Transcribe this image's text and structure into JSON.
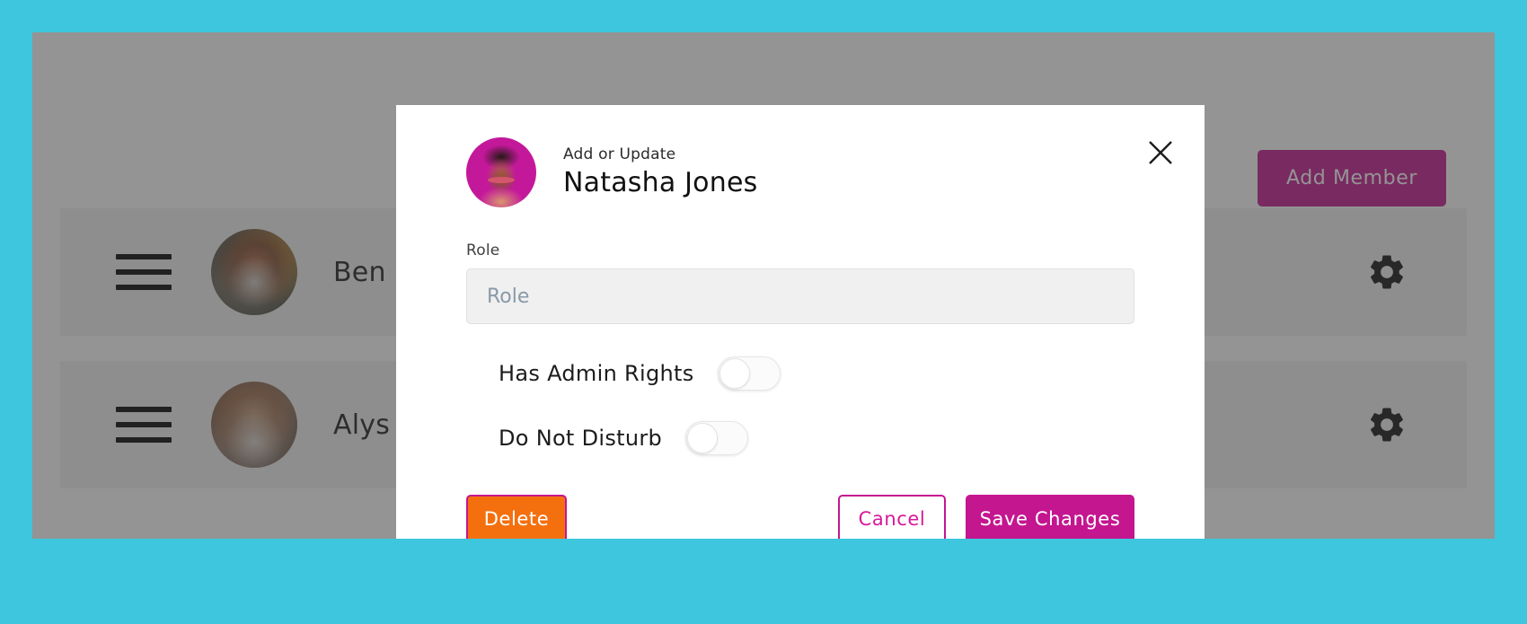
{
  "theme": {
    "page_background": "#3dc6dd",
    "accent_magenta": "#c4168f",
    "delete_orange": "#f4700f",
    "panel_background": "#ffffff",
    "row_background": "#f2f2f2",
    "overlay": "rgba(60,60,60,0.55)"
  },
  "background_page": {
    "add_member_label": "Add Member",
    "members": [
      {
        "name": "Ben",
        "drag_handle_icon": "hamburger-icon",
        "settings_icon": "gear-icon"
      },
      {
        "name": "Alys",
        "drag_handle_icon": "hamburger-icon",
        "settings_icon": "gear-icon"
      }
    ]
  },
  "modal": {
    "close_icon": "close-icon",
    "eyebrow": "Add or Update",
    "title": "Natasha Jones",
    "avatar_icon": "user-avatar",
    "role_field": {
      "label": "Role",
      "placeholder": "Role",
      "value": ""
    },
    "toggles": [
      {
        "label": "Has Admin Rights",
        "state": "off"
      },
      {
        "label": "Do Not Disturb",
        "state": "off"
      }
    ],
    "buttons": {
      "delete": "Delete",
      "cancel": "Cancel",
      "save": "Save Changes"
    }
  }
}
